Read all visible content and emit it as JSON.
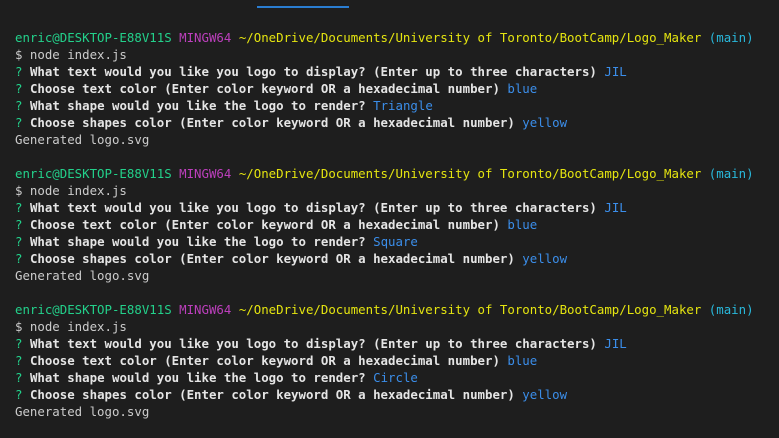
{
  "theme": {
    "background": "#1e1e1e",
    "prompt_user_color": "#23d18b",
    "prompt_env_color": "#bc3fbc",
    "prompt_path_color": "#e5e510",
    "prompt_branch_color": "#29b8db",
    "question_mark_color": "#23d18b",
    "answer_color": "#3b8eea",
    "text_color": "#cccccc"
  },
  "runs": [
    {
      "prompt": {
        "user_host": "enric@DESKTOP-E88V11S",
        "env": "MINGW64",
        "path": "~/OneDrive/Documents/University of Toronto/BootCamp/Logo_Maker",
        "branch": "(main)"
      },
      "command": "$ node index.js",
      "qa": [
        {
          "mark": "?",
          "question": "What text would you like you logo to display? (Enter up to three characters)",
          "answer": "JIL"
        },
        {
          "mark": "?",
          "question": "Choose text color (Enter color keyword OR a hexadecimal number)",
          "answer": "blue"
        },
        {
          "mark": "?",
          "question": "What shape would you like the logo to render?",
          "answer": "Triangle"
        },
        {
          "mark": "?",
          "question": "Choose shapes color (Enter color keyword OR a hexadecimal number)",
          "answer": "yellow"
        }
      ],
      "result": "Generated logo.svg"
    },
    {
      "prompt": {
        "user_host": "enric@DESKTOP-E88V11S",
        "env": "MINGW64",
        "path": "~/OneDrive/Documents/University of Toronto/BootCamp/Logo_Maker",
        "branch": "(main)"
      },
      "command": "$ node index.js",
      "qa": [
        {
          "mark": "?",
          "question": "What text would you like you logo to display? (Enter up to three characters)",
          "answer": "JIL"
        },
        {
          "mark": "?",
          "question": "Choose text color (Enter color keyword OR a hexadecimal number)",
          "answer": "blue"
        },
        {
          "mark": "?",
          "question": "What shape would you like the logo to render?",
          "answer": "Square"
        },
        {
          "mark": "?",
          "question": "Choose shapes color (Enter color keyword OR a hexadecimal number)",
          "answer": "yellow"
        }
      ],
      "result": "Generated logo.svg"
    },
    {
      "prompt": {
        "user_host": "enric@DESKTOP-E88V11S",
        "env": "MINGW64",
        "path": "~/OneDrive/Documents/University of Toronto/BootCamp/Logo_Maker",
        "branch": "(main)"
      },
      "command": "$ node index.js",
      "qa": [
        {
          "mark": "?",
          "question": "What text would you like you logo to display? (Enter up to three characters)",
          "answer": "JIL"
        },
        {
          "mark": "?",
          "question": "Choose text color (Enter color keyword OR a hexadecimal number)",
          "answer": "blue"
        },
        {
          "mark": "?",
          "question": "What shape would you like the logo to render?",
          "answer": "Circle"
        },
        {
          "mark": "?",
          "question": "Choose shapes color (Enter color keyword OR a hexadecimal number)",
          "answer": "yellow"
        }
      ],
      "result": "Generated logo.svg"
    }
  ]
}
